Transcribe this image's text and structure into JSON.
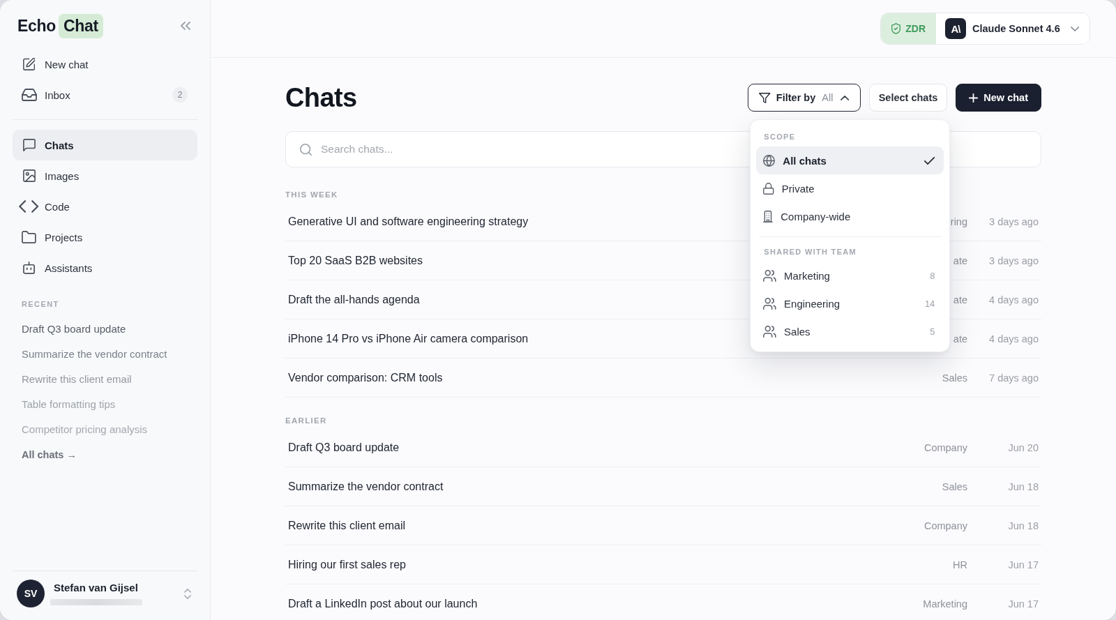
{
  "sidebar": {
    "logo": {
      "word": "Echo",
      "highlight": "Chat"
    },
    "actions": [
      {
        "label": "New chat"
      },
      {
        "label": "Inbox",
        "badge": "2"
      }
    ],
    "nav": [
      {
        "label": "Chats",
        "selected": true
      },
      {
        "label": "Images",
        "selected": false
      },
      {
        "label": "Code",
        "selected": false
      },
      {
        "label": "Projects",
        "selected": false
      },
      {
        "label": "Assistants",
        "selected": false
      }
    ],
    "recent": {
      "heading": "RECENT",
      "items": [
        "Draft Q3 board update",
        "Summarize the vendor contract",
        "Rewrite this client email",
        "Table formatting tips",
        "Competitor pricing analysis"
      ],
      "all_link": "All chats →"
    },
    "user": {
      "initials": "SV",
      "name": "Stefan van Gijsel"
    }
  },
  "top_bar": {
    "zdr": "ZDR",
    "model": {
      "logo": "A\\",
      "name": "Claude Sonnet 4.6"
    }
  },
  "page": {
    "title": "Chats",
    "filter": {
      "label": "Filter by",
      "value": "All",
      "expanded": true,
      "menu": {
        "groups": [
          {
            "heading": "SCOPE",
            "items": [
              {
                "label": "All chats",
                "selected": true
              },
              {
                "label": "Private",
                "selected": false
              },
              {
                "label": "Company-wide",
                "selected": false
              }
            ]
          },
          {
            "heading": "SHARED WITH TEAM",
            "items": [
              {
                "label": "Marketing",
                "count": "8",
                "selected": false
              },
              {
                "label": "Engineering",
                "count": "14",
                "selected": false
              },
              {
                "label": "Sales",
                "count": "5",
                "selected": false
              }
            ]
          }
        ]
      }
    },
    "select_button": "Select chats",
    "new_button": "New chat",
    "search": {
      "placeholder": "Search chats..."
    },
    "sections": [
      {
        "heading": "THIS WEEK",
        "rows": [
          {
            "title": "Generative UI and software engineering strategy",
            "tag": "ring",
            "date": "3 days ago"
          },
          {
            "title": "Top 20 SaaS B2B websites",
            "tag": "ate",
            "date": "3 days ago"
          },
          {
            "title": "Draft the all-hands agenda",
            "tag": "ate",
            "date": "4 days ago"
          },
          {
            "title": "iPhone 14 Pro vs iPhone Air camera comparison",
            "tag": "ate",
            "date": "4 days ago"
          },
          {
            "title": "Vendor comparison: CRM tools",
            "tag": "Sales",
            "date": "7 days ago"
          }
        ]
      },
      {
        "heading": "EARLIER",
        "rows": [
          {
            "title": "Draft Q3 board update",
            "tag": "Company",
            "date": "Jun 20"
          },
          {
            "title": "Summarize the vendor contract",
            "tag": "Sales",
            "date": "Jun 18"
          },
          {
            "title": "Rewrite this client email",
            "tag": "Company",
            "date": "Jun 18"
          },
          {
            "title": "Hiring our first sales rep",
            "tag": "HR",
            "date": "Jun 17"
          },
          {
            "title": "Draft a LinkedIn post about our launch",
            "tag": "Marketing",
            "date": "Jun 17"
          }
        ]
      }
    ]
  }
}
